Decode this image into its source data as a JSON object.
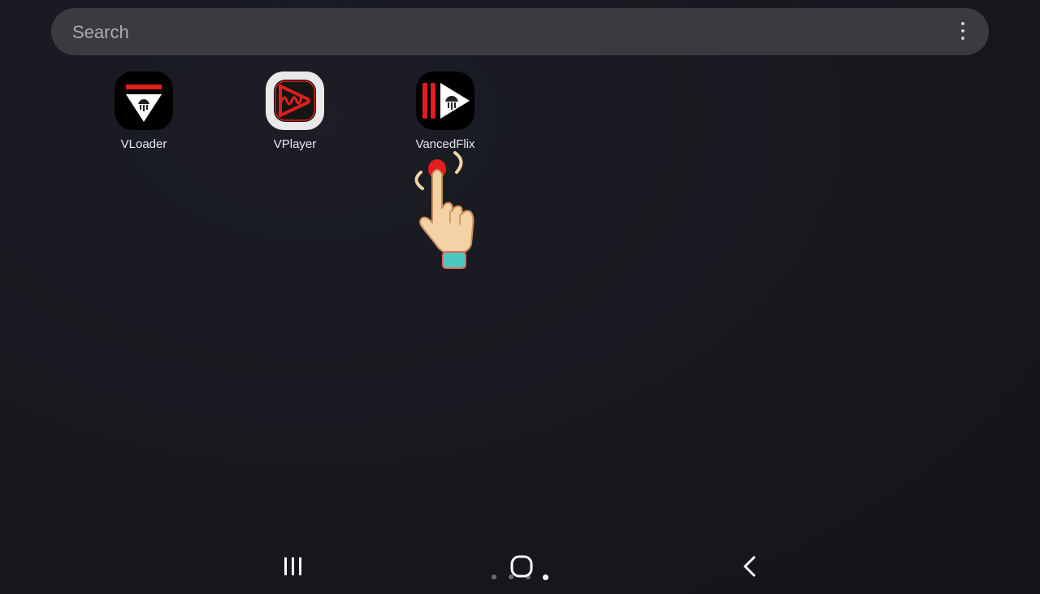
{
  "search": {
    "placeholder": "Search",
    "menu_icon": "more-vert-icon"
  },
  "apps": [
    {
      "label": "VLoader",
      "icon": "vloader-app-icon"
    },
    {
      "label": "VPlayer",
      "icon": "vplayer-app-icon"
    },
    {
      "label": "VancedFlix",
      "icon": "vancedflix-app-icon"
    }
  ],
  "overlay": {
    "pointer_icon": "tap-hand-icon"
  },
  "navigation": {
    "recents_icon": "recents-icon",
    "home_icon": "home-icon",
    "back_icon": "back-icon"
  },
  "pager": {
    "count": 4,
    "active_index": 3
  },
  "colors": {
    "background": "#17181e",
    "search_bar": "#3a3b3f",
    "accent_red": "#e01e1e",
    "label": "#e8e9ec"
  }
}
